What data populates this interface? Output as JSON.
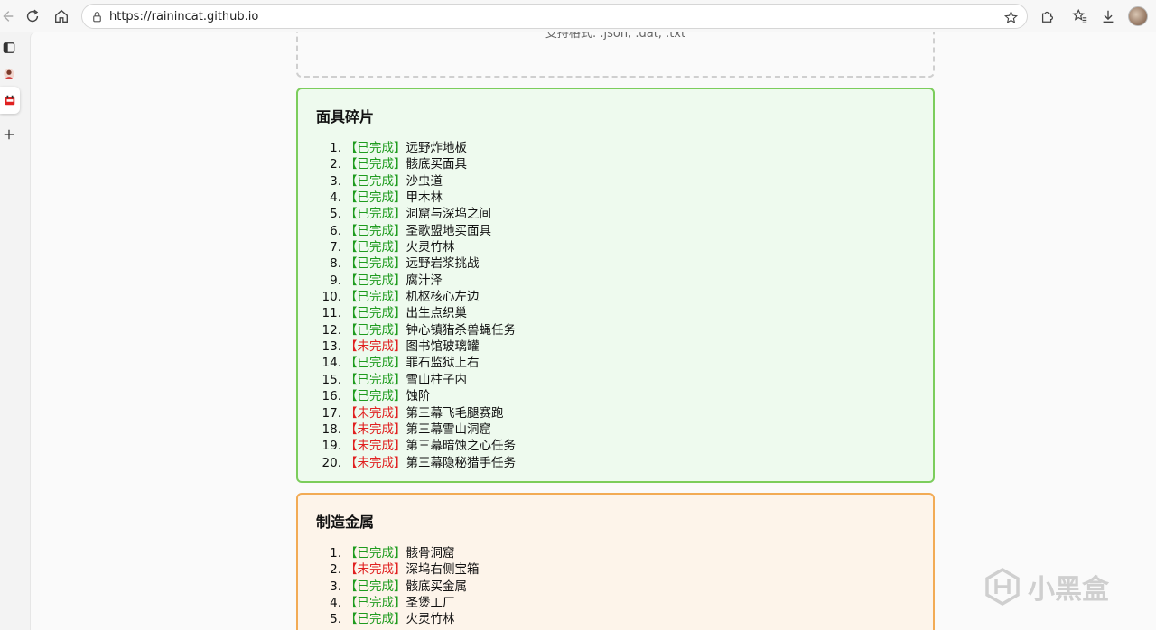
{
  "browser": {
    "url": "https://rainincat.github.io"
  },
  "upload": {
    "hint": "支持格式: .json, .dat, .txt"
  },
  "sections": [
    {
      "title": "面具碎片",
      "items": [
        {
          "num": "1.",
          "status": "【已完成】",
          "done": true,
          "label": "远野炸地板"
        },
        {
          "num": "2.",
          "status": "【已完成】",
          "done": true,
          "label": "骸底买面具"
        },
        {
          "num": "3.",
          "status": "【已完成】",
          "done": true,
          "label": "沙虫道"
        },
        {
          "num": "4.",
          "status": "【已完成】",
          "done": true,
          "label": "甲木林"
        },
        {
          "num": "5.",
          "status": "【已完成】",
          "done": true,
          "label": "洞窟与深坞之间"
        },
        {
          "num": "6.",
          "status": "【已完成】",
          "done": true,
          "label": "圣歌盟地买面具"
        },
        {
          "num": "7.",
          "status": "【已完成】",
          "done": true,
          "label": "火灵竹林"
        },
        {
          "num": "8.",
          "status": "【已完成】",
          "done": true,
          "label": "远野岩浆挑战"
        },
        {
          "num": "9.",
          "status": "【已完成】",
          "done": true,
          "label": "腐汁泽"
        },
        {
          "num": "10.",
          "status": "【已完成】",
          "done": true,
          "label": "机枢核心左边"
        },
        {
          "num": "11.",
          "status": "【已完成】",
          "done": true,
          "label": "出生点织巢"
        },
        {
          "num": "12.",
          "status": "【已完成】",
          "done": true,
          "label": "钟心镇猎杀兽蝇任务"
        },
        {
          "num": "13.",
          "status": "【未完成】",
          "done": false,
          "label": "图书馆玻璃罐"
        },
        {
          "num": "14.",
          "status": "【已完成】",
          "done": true,
          "label": "罪石监狱上右"
        },
        {
          "num": "15.",
          "status": "【已完成】",
          "done": true,
          "label": "雪山柱子内"
        },
        {
          "num": "16.",
          "status": "【已完成】",
          "done": true,
          "label": "蚀阶"
        },
        {
          "num": "17.",
          "status": "【未完成】",
          "done": false,
          "label": "第三幕飞毛腿赛跑"
        },
        {
          "num": "18.",
          "status": "【未完成】",
          "done": false,
          "label": "第三幕雪山洞窟"
        },
        {
          "num": "19.",
          "status": "【未完成】",
          "done": false,
          "label": "第三幕暗蚀之心任务"
        },
        {
          "num": "20.",
          "status": "【未完成】",
          "done": false,
          "label": "第三幕隐秘猎手任务"
        }
      ]
    },
    {
      "title": "制造金属",
      "items": [
        {
          "num": "1.",
          "status": "【已完成】",
          "done": true,
          "label": "骸骨洞窟"
        },
        {
          "num": "2.",
          "status": "【未完成】",
          "done": false,
          "label": "深坞右侧宝箱"
        },
        {
          "num": "3.",
          "status": "【已完成】",
          "done": true,
          "label": "骸底买金属"
        },
        {
          "num": "4.",
          "status": "【已完成】",
          "done": true,
          "label": "圣煲工厂"
        },
        {
          "num": "5.",
          "status": "【已完成】",
          "done": true,
          "label": "火灵竹林"
        }
      ]
    }
  ],
  "watermark": {
    "text": "小黑盒"
  },
  "colors": {
    "done": "#1e9b1e",
    "todo": "#e02020",
    "green_border": "#7ccd5c",
    "orange_border": "#f2ab55"
  }
}
